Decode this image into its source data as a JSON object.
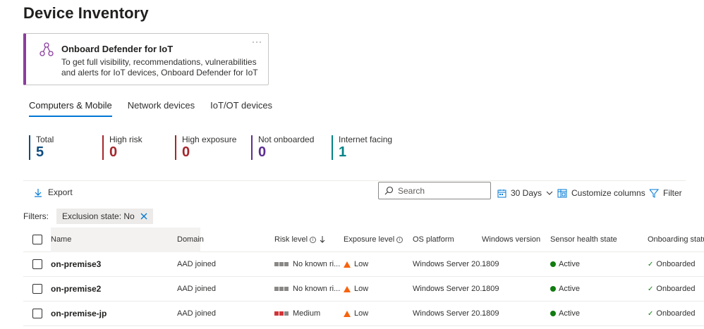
{
  "page": {
    "title": "Device Inventory"
  },
  "onboard_card": {
    "title": "Onboard Defender for IoT",
    "description": "To get full visibility, recommendations, vulnerabilities and alerts for IoT devices, Onboard Defender for IoT",
    "more": "···"
  },
  "tabs": [
    {
      "label": "Computers & Mobile",
      "active": true
    },
    {
      "label": "Network devices",
      "active": false
    },
    {
      "label": "IoT/OT devices",
      "active": false
    }
  ],
  "stats": [
    {
      "label": "Total",
      "value": "5",
      "color": "#0f4c81"
    },
    {
      "label": "High risk",
      "value": "0",
      "color": "#a4262c"
    },
    {
      "label": "High exposure",
      "value": "0",
      "color": "#a4262c"
    },
    {
      "label": "Not onboarded",
      "value": "0",
      "color": "#5c2e91"
    },
    {
      "label": "Internet facing",
      "value": "1",
      "color": "#038387"
    }
  ],
  "toolbar": {
    "export_label": "Export",
    "search_placeholder": "Search",
    "days_label": "30 Days",
    "customize_label": "Customize columns",
    "filter_label": "Filter"
  },
  "filters": {
    "label": "Filters:",
    "chip": "Exclusion state: No"
  },
  "table": {
    "headers": {
      "name": "Name",
      "domain": "Domain",
      "risk": "Risk level",
      "exposure": "Exposure level",
      "os": "OS platform",
      "winver": "Windows version",
      "sensor": "Sensor health state",
      "onboarding": "Onboarding status"
    },
    "rows": [
      {
        "name": "on-premise3",
        "domain": "AAD joined",
        "risk": "No known ri...",
        "risk_level": "none",
        "exposure": "Low",
        "os": "Windows Server 20...",
        "winver": "1809",
        "sensor": "Active",
        "onboarding": "Onboarded"
      },
      {
        "name": "on-premise2",
        "domain": "AAD joined",
        "risk": "No known ri...",
        "risk_level": "none",
        "exposure": "Low",
        "os": "Windows Server 20...",
        "winver": "1809",
        "sensor": "Active",
        "onboarding": "Onboarded"
      },
      {
        "name": "on-premise-jp",
        "domain": "AAD joined",
        "risk": "Medium",
        "risk_level": "medium",
        "exposure": "Low",
        "os": "Windows Server 20...",
        "winver": "1809",
        "sensor": "Active",
        "onboarding": "Onboarded"
      }
    ]
  },
  "colors": {
    "accent": "#0078d4",
    "card_border": "#8b3d9e",
    "risk_medium": "#d13438",
    "risk_none": "#8a8886",
    "warning": "#f7630c",
    "success": "#107c10"
  }
}
